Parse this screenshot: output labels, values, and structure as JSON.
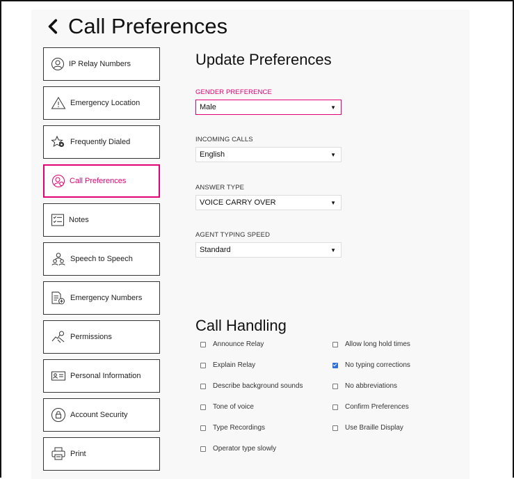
{
  "header": {
    "title": "Call Preferences"
  },
  "sidebar": {
    "items": [
      {
        "label": "IP Relay Numbers",
        "icon": "person-circle-icon"
      },
      {
        "label": "Emergency Location",
        "icon": "warning-triangle-icon"
      },
      {
        "label": "Frequently Dialed",
        "icon": "star-gear-icon"
      },
      {
        "label": "Call Preferences",
        "icon": "person-gear-icon",
        "active": true
      },
      {
        "label": "Notes",
        "icon": "checklist-icon"
      },
      {
        "label": "Speech to Speech",
        "icon": "people-icon"
      },
      {
        "label": "Emergency Numbers",
        "icon": "document-plus-icon"
      },
      {
        "label": "Permissions",
        "icon": "hand-key-icon"
      },
      {
        "label": "Personal Information",
        "icon": "id-card-icon"
      },
      {
        "label": "Account Security",
        "icon": "lock-circle-icon"
      },
      {
        "label": "Print",
        "icon": "printer-icon"
      }
    ]
  },
  "preferences": {
    "heading": "Update Preferences",
    "fields": [
      {
        "label": "GENDER PREFERENCE",
        "value": "Male"
      },
      {
        "label": "INCOMING CALLS",
        "value": "English"
      },
      {
        "label": "ANSWER TYPE",
        "value": "VOICE CARRY OVER"
      },
      {
        "label": "AGENT TYPING SPEED",
        "value": "Standard"
      }
    ]
  },
  "call_handling": {
    "heading": "Call Handling",
    "left": [
      {
        "label": "Announce Relay",
        "checked": false
      },
      {
        "label": "Explain Relay",
        "checked": false
      },
      {
        "label": "Describe background sounds",
        "checked": false
      },
      {
        "label": "Tone of voice",
        "checked": false
      },
      {
        "label": "Type Recordings",
        "checked": false
      },
      {
        "label": "Operator type slowly",
        "checked": false
      }
    ],
    "right": [
      {
        "label": "Allow long hold times",
        "checked": false
      },
      {
        "label": "No typing corrections",
        "checked": true
      },
      {
        "label": "No abbreviations",
        "checked": false
      },
      {
        "label": "Confirm Preferences",
        "checked": false
      },
      {
        "label": "Use Braille Display",
        "checked": false
      }
    ]
  },
  "colors": {
    "accent": "#e20074",
    "checkbox": "#2e6fd8"
  }
}
